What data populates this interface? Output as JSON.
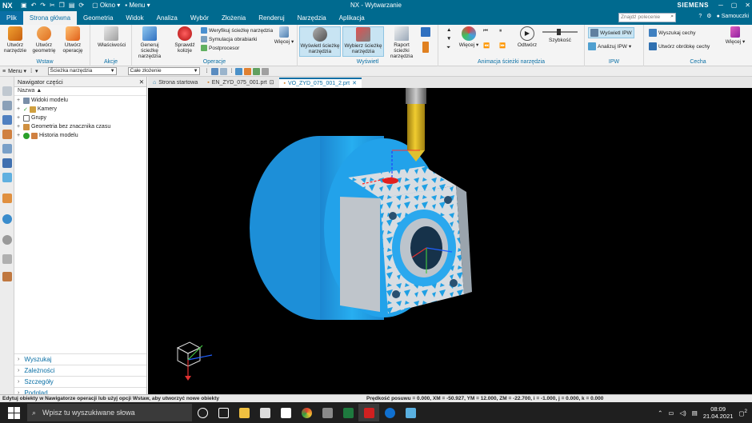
{
  "titlebar": {
    "app_logo": "NX",
    "okno": "Okno",
    "menu": "Menu",
    "title": "NX - Wytwarzanie",
    "brand": "SIEMENS"
  },
  "tabs": [
    {
      "label": "Plik"
    },
    {
      "label": "Strona główna"
    },
    {
      "label": "Geometria"
    },
    {
      "label": "Widok"
    },
    {
      "label": "Analiza"
    },
    {
      "label": "Wybór"
    },
    {
      "label": "Złożenia"
    },
    {
      "label": "Renderuj"
    },
    {
      "label": "Narzędzia"
    },
    {
      "label": "Aplikacja"
    }
  ],
  "command_search": {
    "placeholder": "Znajdź polecenie"
  },
  "user": "Samouczki",
  "ribbon": {
    "wstaw": {
      "label": "Wstaw",
      "btn1": "Utwórz narzędzie",
      "btn2": "Utwórz geometrię",
      "btn3": "Utwórz operację"
    },
    "akcje": {
      "label": "Akcje",
      "btn1": "Właściwości"
    },
    "operacje": {
      "label": "Operacje",
      "btn1": "Generuj ścieżkę narzędzia",
      "btn2": "Sprawdź kolizje",
      "s1": "Weryfikuj ścieżkę narzędzia",
      "s2": "Symulacja obrabiarki",
      "s3": "Postprocesor",
      "more": "Więcej"
    },
    "wyswietl": {
      "label": "Wyświetl",
      "btn1": "Wyświetl ścieżkę narzędzia",
      "btn2": "Wybierz ścieżkę narzędzia",
      "btn3": "Raport ścieżki narzędzia"
    },
    "animacja": {
      "label": "Animacja ścieżki narzędzia",
      "more": "Więcej",
      "odtworz": "Odtwórz",
      "szybkosc": "Szybkość"
    },
    "ipw": {
      "label": "IPW",
      "btn1": "Wyświetl IPW",
      "btn2": "Analizuj IPW"
    },
    "cecha": {
      "label": "Cecha",
      "btn1": "Wyszukaj cechy",
      "btn2": "Utwórz obróbkę cechy",
      "more": "Więcej"
    }
  },
  "toolbar2": {
    "menu": "Menu",
    "filter": "Ścieżka narzędzia",
    "scope": "Całe złożenie"
  },
  "navigator": {
    "title": "Nawigator części",
    "column": "Nazwa",
    "items": [
      {
        "label": "Widoki modelu"
      },
      {
        "label": "Kamery"
      },
      {
        "label": "Grupy"
      },
      {
        "label": "Geometria bez znacznika czasu"
      },
      {
        "label": "Historia modelu"
      }
    ],
    "sections": [
      {
        "label": "Wyszukaj"
      },
      {
        "label": "Zależności"
      },
      {
        "label": "Szczegóły"
      },
      {
        "label": "Podgląd"
      }
    ]
  },
  "doc_tabs": [
    {
      "label": "Strona startowa"
    },
    {
      "label": "EN_ZYD_075_001.prt"
    },
    {
      "label": "VO_ZYD_075_001_2.prt"
    }
  ],
  "status": {
    "message": "Edytuj obiekty w Nawigatorze operacji lub użyj opcji Wstaw, aby utworzyć nowe obiekty",
    "readout": "Prędkość posuwu = 0.000, XM = -50.927, YM = 12.000, ZM = -22.700, i = -1.000, j = 0.000, k = 0.000"
  },
  "taskbar": {
    "search_placeholder": "Wpisz tu wyszukiwane słowa",
    "time": "08:09",
    "date": "21.04.2021",
    "notif": "2"
  },
  "colors": {
    "titlebar": "#006a8f",
    "accent": "#0a6fa5",
    "part": "#1fa3e6",
    "tool": "#d9b21a"
  }
}
